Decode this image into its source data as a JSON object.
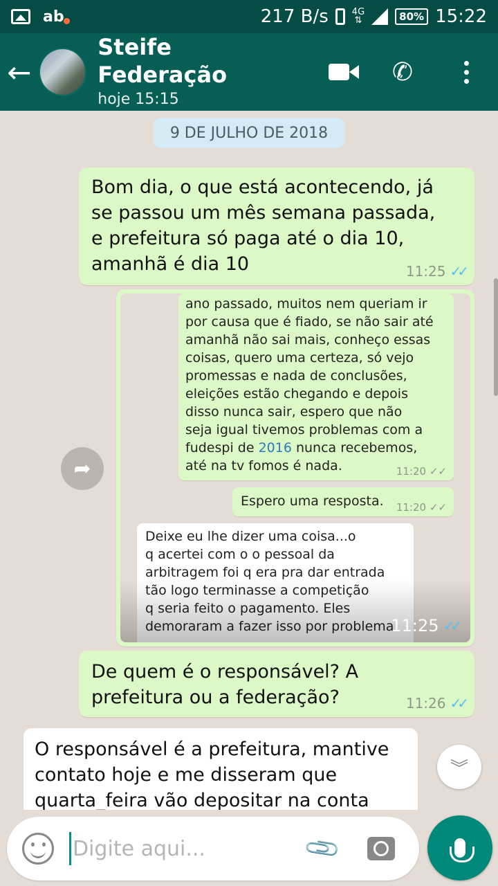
{
  "status_bar": {
    "speed": "217 B/s",
    "network": "4G",
    "battery": "80%",
    "time": "15:22"
  },
  "header": {
    "back_icon": "arrow-left-icon",
    "contact_name": "Steife Federação",
    "last_seen": "hoje 15:15"
  },
  "chat": {
    "date_chip": "9 DE JULHO DE 2018",
    "messages": [
      {
        "direction": "out",
        "text": "Bom dia, o que está acontecendo, já\nse passou um mês semana passada,\ne prefeitura só paga até o dia 10,\namanhã é dia 10",
        "time": "11:25",
        "status": "read"
      },
      {
        "direction": "out",
        "type": "image",
        "time": "11:25",
        "status": "read",
        "image_content": {
          "msg1_text_a": "ano passado, muitos nem queriam ir\npor causa que é fiado, se não sair até\namanhã não sai mais, conheço essas\ncoisas, quero uma certeza, só vejo\npromessas e nada de conclusões,\neleições estão chegando e depois\ndisso nunca sair, espero que não\nseja igual tivemos problemas com a",
          "msg1_text_b": "fudespi de ",
          "msg1_year": "2016",
          "msg1_text_c": " nunca recebemos,\naté na tv fomos é nada.",
          "msg1_time": "11:20",
          "msg2_text": "Espero uma resposta.",
          "msg2_time": "11:20",
          "msg3_text": "Deixe eu lhe dizer uma coisa...o\nq acertei com o o pessoal da\narbitragem foi q era pra dar entrada\ntão logo terminasse a competição\nq seria feito o pagamento. Eles\ndemoraram a fazer isso por problema"
        }
      },
      {
        "direction": "out",
        "text": "De quem é o responsável? A\nprefeitura ou a federação?",
        "time": "11:26",
        "status": "read"
      },
      {
        "direction": "in",
        "text": "O responsável é a prefeitura, mantive\ncontato hoje e me disseram que\nquarta_feira  vão depositar na conta"
      }
    ]
  },
  "composer": {
    "placeholder": "Digite aqui..."
  },
  "colors": {
    "header": "#075e54",
    "status_bar": "#054d44",
    "outgoing_bubble": "#dcf8c6",
    "incoming_bubble": "#ffffff",
    "read_ticks": "#4fc3f7",
    "mic_button": "#00897b"
  }
}
